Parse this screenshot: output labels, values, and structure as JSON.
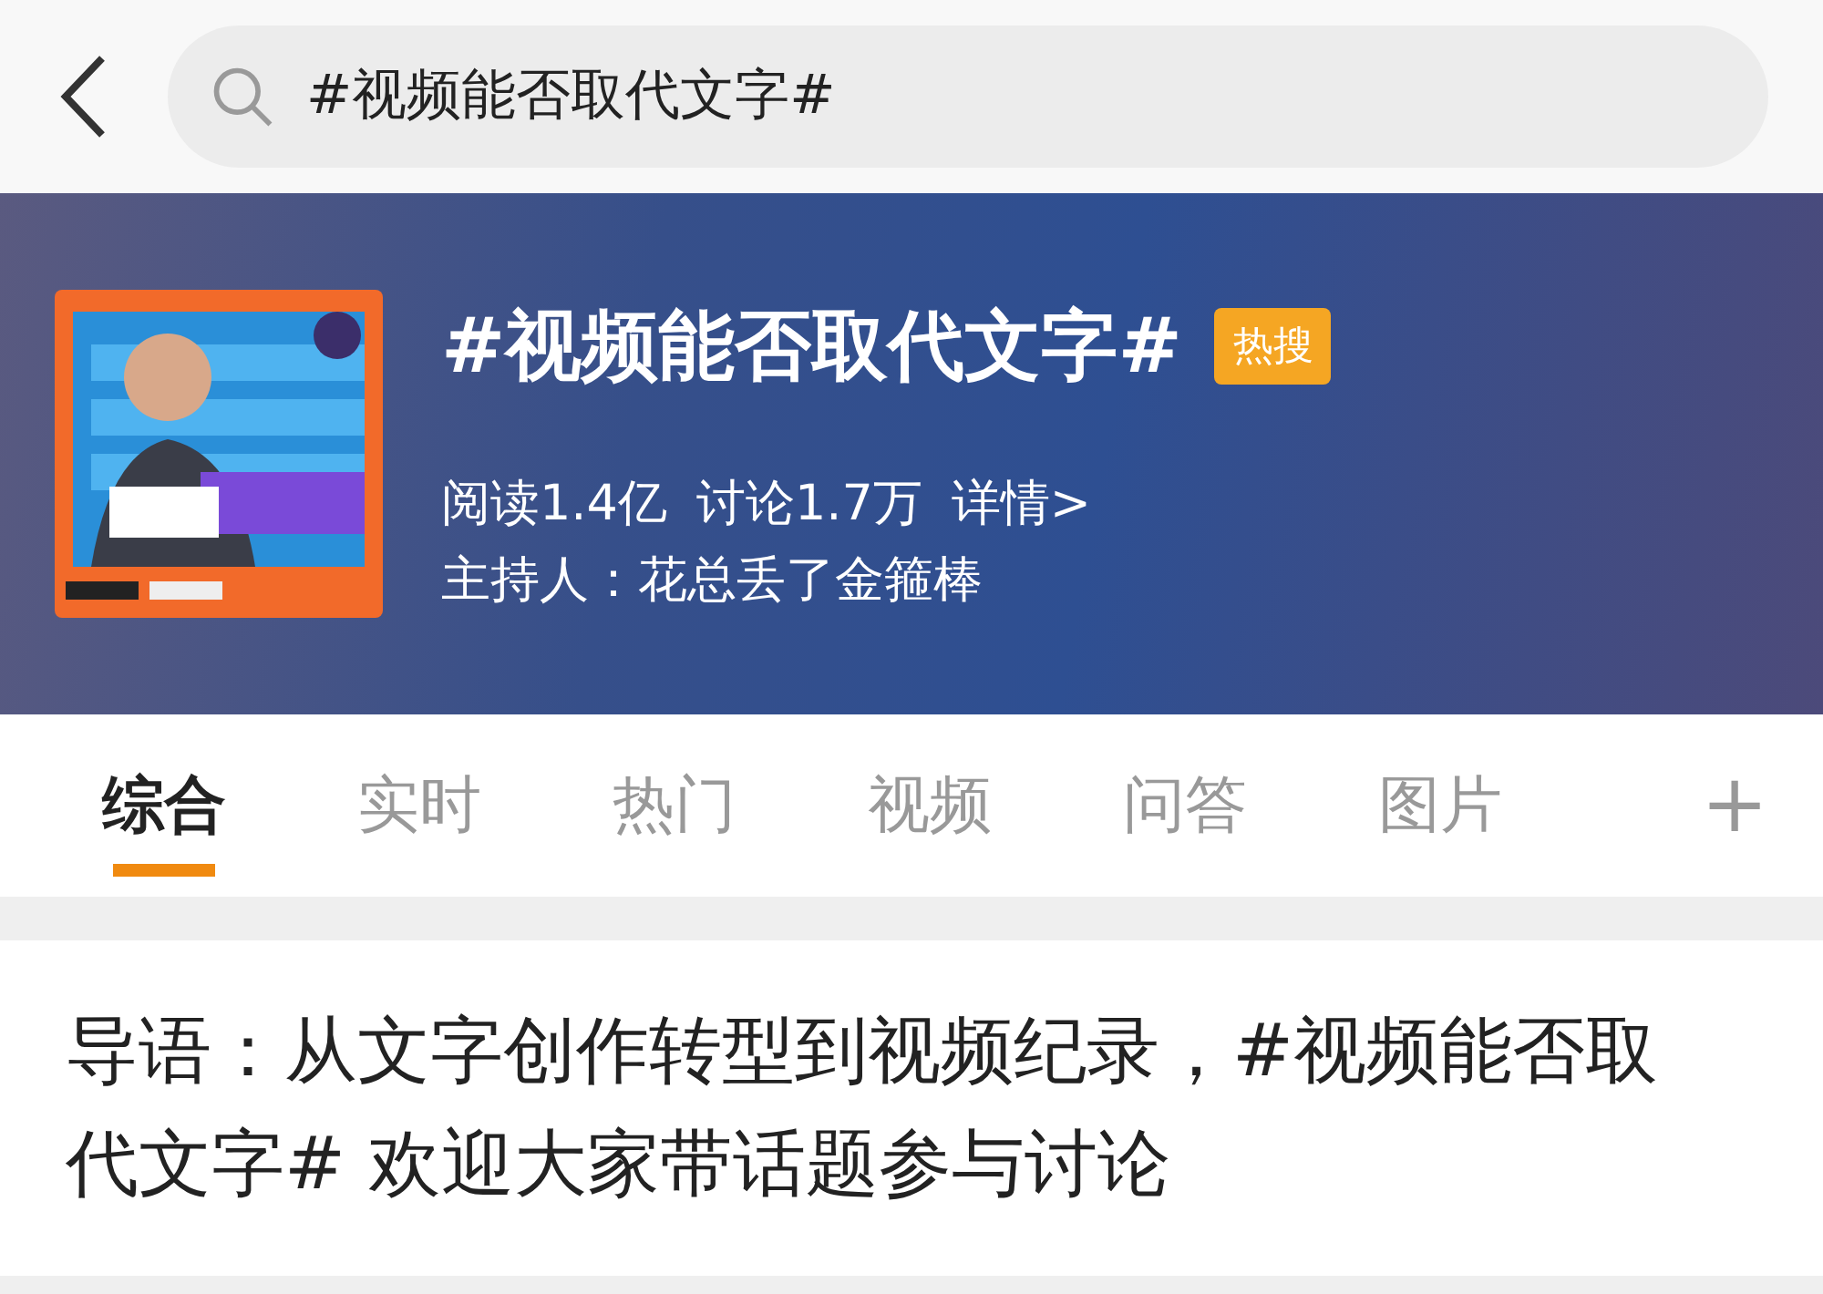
{
  "search": {
    "value": "#视频能否取代文字#"
  },
  "topic": {
    "title": "#视频能否取代文字#",
    "badge": "热搜",
    "stats": [
      "阅读1.4亿",
      "讨论1.7万",
      "详情>"
    ],
    "host": "主持人：花总丢了金箍棒"
  },
  "tabs": [
    {
      "label": "综合",
      "selected": true
    },
    {
      "label": "实时",
      "selected": false
    },
    {
      "label": "热门",
      "selected": false
    },
    {
      "label": "视频",
      "selected": false
    },
    {
      "label": "问答",
      "selected": false
    },
    {
      "label": "图片",
      "selected": false
    }
  ],
  "add_tab": "+",
  "intro": "导语：从文字创作转型到视频纪录，#视频能否取代文字# 欢迎大家带话题参与讨论"
}
